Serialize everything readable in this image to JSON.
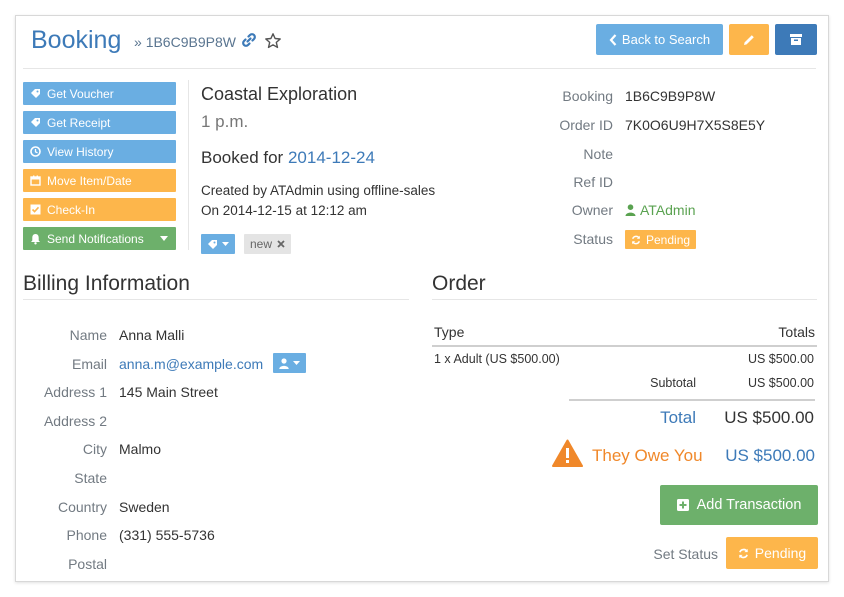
{
  "header": {
    "title": "Booking",
    "ref_sep": "»",
    "ref_code": "1B6C9B9P8W",
    "back_label": "Back to Search"
  },
  "sidebar": [
    {
      "label": "Get Voucher",
      "icon": "ticket-icon",
      "color": "#6aaee2"
    },
    {
      "label": "Get Receipt",
      "icon": "ticket-icon",
      "color": "#6aaee2"
    },
    {
      "label": "View History",
      "icon": "clock-icon",
      "color": "#6aaee2"
    },
    {
      "label": "Move Item/Date",
      "icon": "calendar-icon",
      "color": "#fdb64b"
    },
    {
      "label": "Check-In",
      "icon": "check-square-icon",
      "color": "#fdb64b"
    },
    {
      "label": "Send Notifications",
      "icon": "bell-icon",
      "color": "#6db06b"
    }
  ],
  "item": {
    "name": "Coastal Exploration",
    "time": "1 p.m.",
    "booked_for_label": "Booked for",
    "booked_for_date": "2014-12-24",
    "created_line": "Created by ATAdmin using offline-sales",
    "created_date_line": "On 2014-12-15 at 12:12 am",
    "tag": "new"
  },
  "details": {
    "booking_label": "Booking",
    "booking_value": "1B6C9B9P8W",
    "order_label": "Order ID",
    "order_value": "7K0O6U9H7X5S8E5Y",
    "note_label": "Note",
    "refid_label": "Ref ID",
    "owner_label": "Owner",
    "owner_value": "ATAdmin",
    "status_label": "Status",
    "status_value": "Pending"
  },
  "billing": {
    "title": "Billing Information",
    "name_label": "Name",
    "name_value": "Anna Malli",
    "email_label": "Email",
    "email_value": "anna.m@example.com",
    "address1_label": "Address 1",
    "address1_value": "145 Main Street",
    "address2_label": "Address 2",
    "city_label": "City",
    "city_value": "Malmo",
    "state_label": "State",
    "country_label": "Country",
    "country_value": "Sweden",
    "phone_label": "Phone",
    "phone_value": "(331) 555-5736",
    "postal_label": "Postal"
  },
  "order": {
    "title": "Order",
    "col_type": "Type",
    "col_totals": "Totals",
    "line_desc": "1 x Adult (US $500.00)",
    "line_amount": "US $500.00",
    "subtotal_label": "Subtotal",
    "subtotal_value": "US $500.00",
    "total_label": "Total",
    "total_value": "US $500.00",
    "owe_label": "They Owe You",
    "owe_value": "US $500.00",
    "add_transaction_label": "Add Transaction",
    "set_status_label": "Set Status",
    "set_status_value": "Pending"
  },
  "colors": {
    "primary": "#3d7ab8",
    "info": "#6aaee2",
    "warning": "#fdb64b",
    "success": "#6db06b",
    "danger_orange": "#f0882a"
  }
}
